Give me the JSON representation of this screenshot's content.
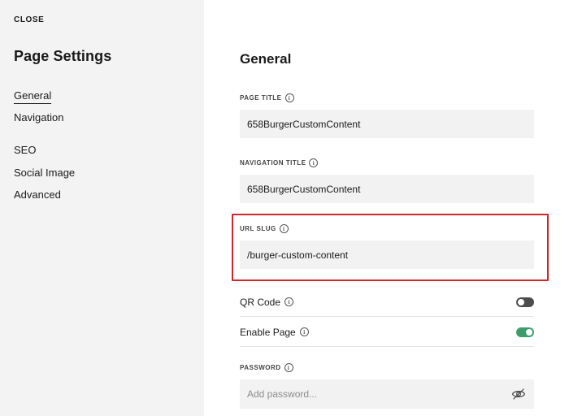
{
  "sidebar": {
    "close_label": "CLOSE",
    "title": "Page Settings",
    "items": [
      {
        "label": "General",
        "active": true
      },
      {
        "label": "Navigation"
      },
      {
        "label": "SEO"
      },
      {
        "label": "Social Image"
      },
      {
        "label": "Advanced"
      }
    ]
  },
  "main": {
    "section_title": "General",
    "page_title": {
      "label": "PAGE TITLE",
      "value": "658BurgerCustomContent"
    },
    "navigation_title": {
      "label": "NAVIGATION TITLE",
      "value": "658BurgerCustomContent"
    },
    "url_slug": {
      "label": "URL SLUG",
      "value": "/burger-custom-content"
    },
    "qr_code": {
      "label": "QR Code",
      "enabled": false
    },
    "enable_page": {
      "label": "Enable Page",
      "enabled": true
    },
    "password": {
      "label": "PASSWORD",
      "value": "",
      "placeholder": "Add password..."
    }
  },
  "colors": {
    "sidebar_bg": "#f3f3f3",
    "field_bg": "#f2f2f2",
    "highlight": "#d0262b",
    "toggle_on": "#3d9c6b",
    "toggle_off": "#4d4d4d"
  },
  "icons": {
    "info": "info-circle-icon",
    "password_visibility": "eye-slash-icon"
  }
}
